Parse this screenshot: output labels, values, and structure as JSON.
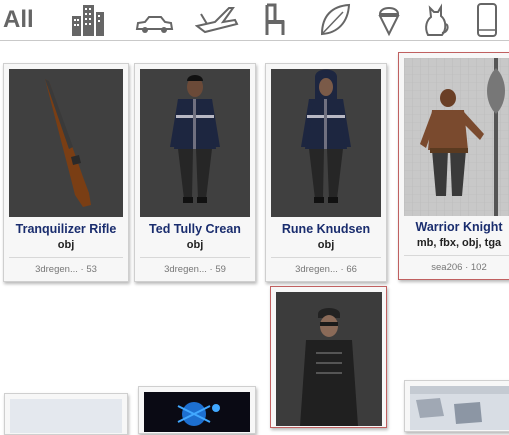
{
  "categories": {
    "all_label": "All",
    "items": [
      {
        "name": "buildings-icon"
      },
      {
        "name": "car-icon"
      },
      {
        "name": "aircraft-icon"
      },
      {
        "name": "chair-icon"
      },
      {
        "name": "leaf-icon"
      },
      {
        "name": "ice-cream-icon"
      },
      {
        "name": "cat-icon"
      },
      {
        "name": "phone-icon"
      }
    ]
  },
  "models": [
    {
      "title": "Tranquilizer Rifle",
      "formats": "obj",
      "author": "3dregen...",
      "count": "53"
    },
    {
      "title": "Ted Tully Crean",
      "formats": "obj",
      "author": "3dregen...",
      "count": "59"
    },
    {
      "title": "Rune Knudsen",
      "formats": "obj",
      "author": "3dregen...",
      "count": "66"
    },
    {
      "title": "Warrior Knight",
      "formats": "mb, fbx, obj, tga",
      "author": "sea206",
      "count": "102"
    }
  ],
  "meta_separator": "·"
}
